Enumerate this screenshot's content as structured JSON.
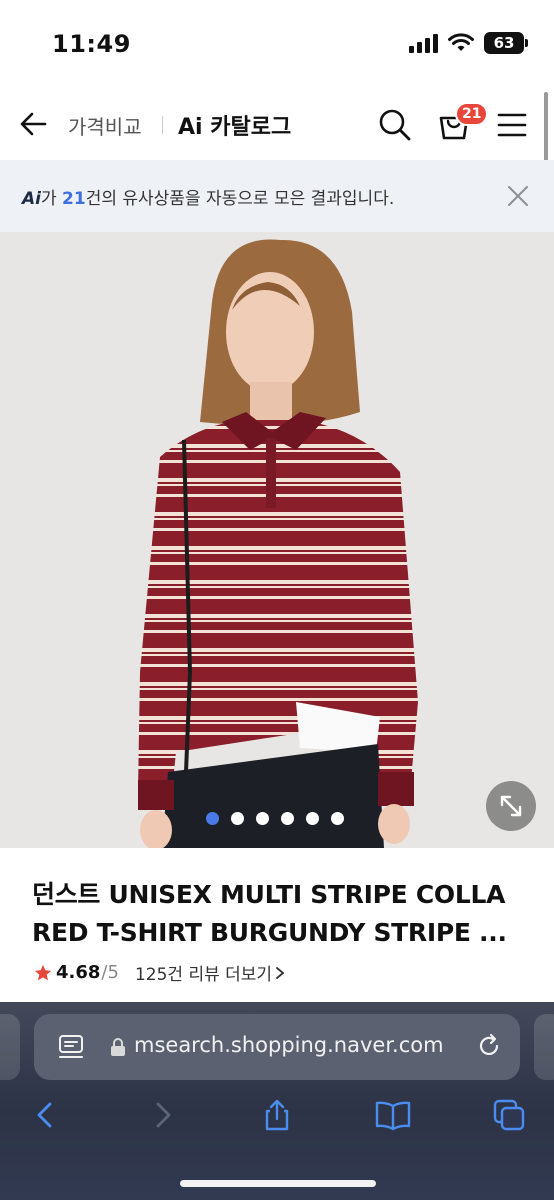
{
  "status": {
    "time": "11:49",
    "battery": "63"
  },
  "header": {
    "compare_label": "가격비교",
    "title": "Ai 카탈로그",
    "cart_count": "21"
  },
  "banner": {
    "ai_mark": "Ai",
    "pre": "가 ",
    "count": "21",
    "post": "건의 유사상품을 자동으로 모은 결과입니다."
  },
  "gallery": {
    "total_images": 6,
    "active_index": 0
  },
  "product": {
    "title": "던스트 UNISEX MULTI STRIPE COLLA RED T-SHIRT BURGUNDY STRIPE ...",
    "rating": "4.68",
    "rating_max": "/5",
    "review_link": "125건 리뷰 더보기",
    "star_color": "#e8463a"
  },
  "browser": {
    "url": "msearch.shopping.naver.com"
  },
  "colors": {
    "accent": "#3d6fe0",
    "badge": "#e8463a",
    "shirt": "#8a1f2b"
  }
}
